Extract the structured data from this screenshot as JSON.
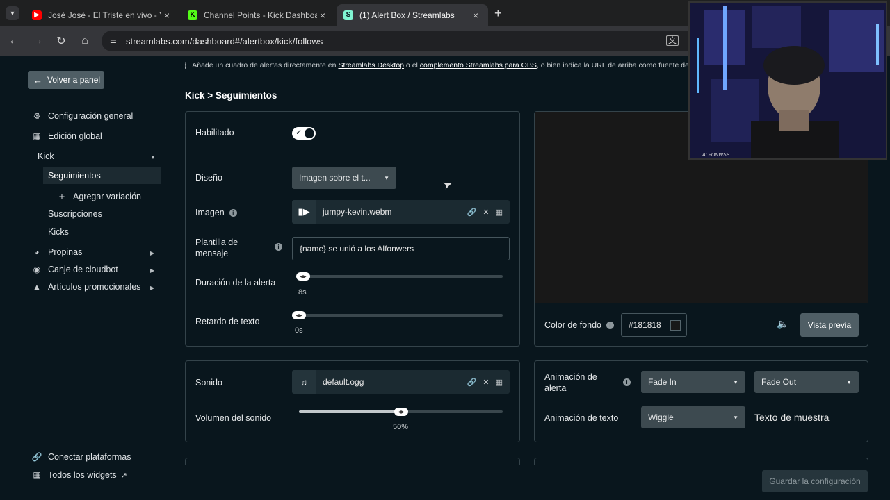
{
  "browser": {
    "tabs": [
      {
        "title": "José José - El Triste en vivo - You",
        "favicon": "youtube-icon",
        "color": "#ff0000"
      },
      {
        "title": "Channel Points - Kick Dashboar",
        "favicon": "kick-icon",
        "color": "#53fc18"
      },
      {
        "title": "(1) Alert Box / Streamlabs",
        "favicon": "streamlabs-icon",
        "color": "#80f5d2"
      }
    ],
    "url": "streamlabs.com/dashboard#/alertbox/kick/follows"
  },
  "sidebar": {
    "back_label": "Volver a panel",
    "items": [
      {
        "label": "Configuración general",
        "icon": "gear-icon"
      },
      {
        "label": "Edición global",
        "icon": "grid-icon"
      },
      {
        "label": "Kick"
      },
      {
        "label": "Seguimientos"
      },
      {
        "label": "Agregar variación",
        "icon": "plus-icon"
      },
      {
        "label": "Suscripciones"
      },
      {
        "label": "Kicks"
      },
      {
        "label": "Propinas",
        "icon": "coin-icon"
      },
      {
        "label": "Canje de cloudbot",
        "icon": "robot-icon"
      },
      {
        "label": "Artículos promocionales",
        "icon": "shirt-icon"
      }
    ],
    "connect_label": "Conectar plataformas",
    "widgets_label": "Todos los widgets"
  },
  "main": {
    "info_text": "Añade un cuadro de alertas directamente en ",
    "info_link1": "Streamlabs Desktop",
    "info_mid": " o el ",
    "info_link2": "complemento Streamlabs para OBS",
    "info_end": ", o bien indica la URL de arriba como fuente de",
    "breadcrumb": "Kick > Seguimientos",
    "settings": {
      "enabled_label": "Habilitado",
      "design_label": "Diseño",
      "design_value": "Imagen sobre el t...",
      "image_label": "Imagen",
      "image_file": "jumpy-kevin.webm",
      "template_label": "Plantilla de mensaje",
      "template_value": "{name} se unió a los Alfonwers",
      "duration_label": "Duración de la alerta",
      "duration_value": "8s",
      "duration_fraction": 0.0,
      "delay_label": "Retardo de texto",
      "delay_value": "0s",
      "delay_fraction": 0.0
    },
    "sound": {
      "sound_label": "Sonido",
      "sound_file": "default.ogg",
      "volume_label": "Volumen del sonido",
      "volume_value": "50%",
      "volume_fraction": 0.5
    },
    "preview": {
      "bg_label": "Color de fondo",
      "bg_color": "#181818",
      "preview_button": "Vista previa"
    },
    "animation": {
      "alert_label": "Animación de alerta",
      "in_value": "Fade In",
      "out_value": "Fade Out",
      "text_label": "Animación de texto",
      "text_value": "Wiggle",
      "sample_text": "Texto de muestra"
    },
    "save_button": "Guardar la configuración"
  },
  "webcam": {
    "overlay_text": "ALFONWSS"
  }
}
